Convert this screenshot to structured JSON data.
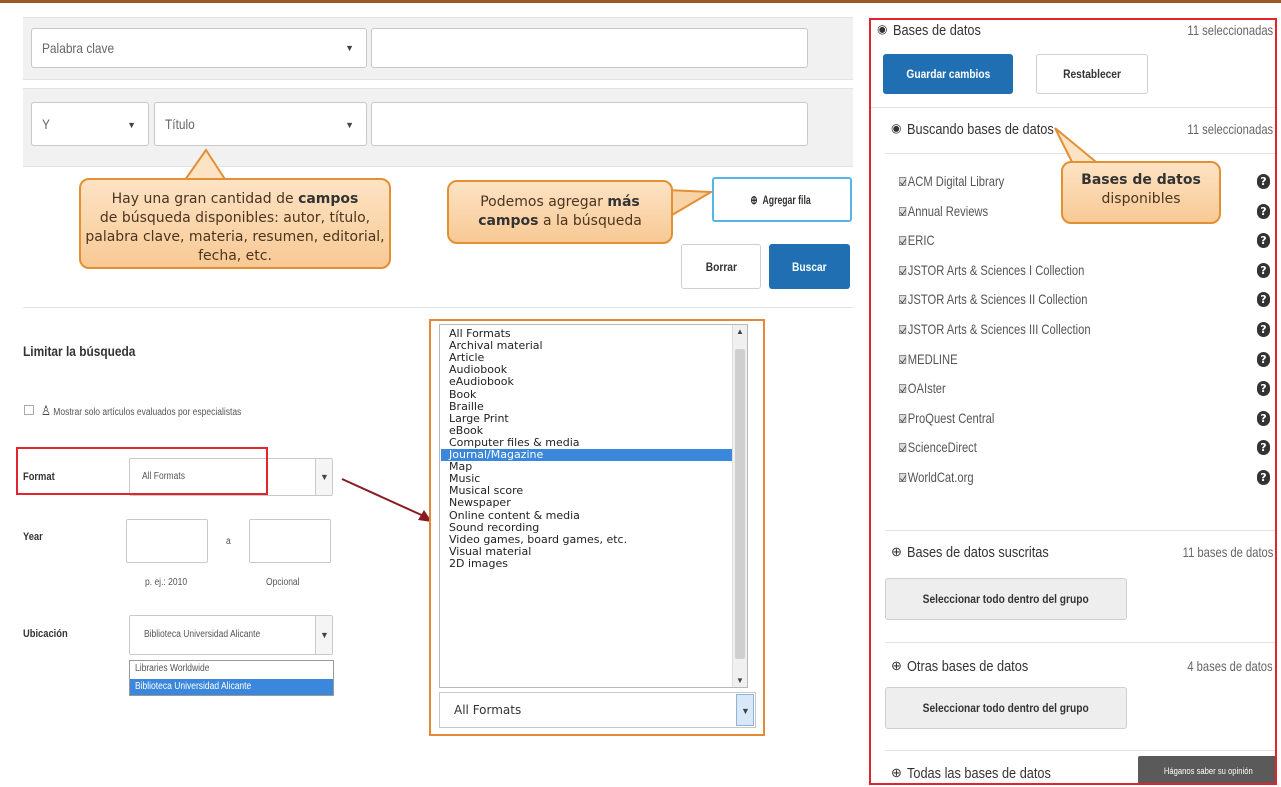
{
  "search": {
    "row1": {
      "field": "Palabra clave",
      "value": ""
    },
    "row2": {
      "operator": "Y",
      "field": "Título",
      "value": ""
    },
    "add_row_label": "Agregar fila",
    "clear_label": "Borrar",
    "search_label": "Buscar"
  },
  "callouts": {
    "fields_pre": "Hay una gran cantidad de ",
    "fields_bold": "campos",
    "fields_post": "de búsqueda disponibles: autor, título, palabra clave, materia, resumen, editorial, fecha, etc.",
    "add_pre": "Podemos agregar ",
    "add_bold1": "más",
    "add_bold2": "campos",
    "add_post": " a  la búsqueda",
    "db_bold": "Bases de datos",
    "db_post": "disponibles"
  },
  "limits": {
    "title": "Limitar la búsqueda",
    "peer_review": "Mostrar solo artículos evaluados por especialistas",
    "format_label": "Format",
    "format_value": "All Formats",
    "year_label": "Year",
    "year_from_placeholder": "p. ej.: 2010",
    "year_sep": "a",
    "year_to_placeholder": "Opcional",
    "location_label": "Ubicación",
    "location_value": "Biblioteca Universidad Alicante",
    "location_options": [
      "Libraries Worldwide",
      "Biblioteca Universidad Alicante"
    ]
  },
  "format_list": {
    "options": [
      "All Formats",
      "Archival material",
      "Article",
      "Audiobook",
      "eAudiobook",
      "Book",
      "Braille",
      "Large Print",
      "eBook",
      "Computer files & media",
      "Journal/Magazine",
      "Map",
      "Music",
      "Musical score",
      "Newspaper",
      "Online content & media",
      "Sound recording",
      "Video games, board games, etc.",
      "Visual material",
      "2D images"
    ],
    "selected": "Journal/Magazine",
    "current_value": "All Formats"
  },
  "databases": {
    "header_title": "Bases de datos",
    "header_count": "11 seleccionadas",
    "save_label": "Guardar cambios",
    "reset_label": "Restablecer",
    "searching_title": "Buscando bases de datos",
    "searching_count": "11 seleccionadas",
    "items": [
      "ACM Digital Library",
      "Annual Reviews",
      "ERIC",
      "JSTOR Arts & Sciences I Collection",
      "JSTOR Arts & Sciences II Collection",
      "JSTOR Arts & Sciences III Collection",
      "MEDLINE",
      "OAIster",
      "ProQuest Central",
      "ScienceDirect",
      "WorldCat.org"
    ],
    "help_glyph": "?",
    "subscribed_title": "Bases de datos suscritas",
    "subscribed_count": "11 bases de datos",
    "select_all_label": "Seleccionar todo dentro del grupo",
    "other_title": "Otras bases de datos",
    "other_count": "4 bases de datos",
    "all_title": "Todas las bases de datos",
    "feedback_label": "Háganos saber su opinión"
  },
  "colors": {
    "accent_blue": "#1f6fb2",
    "highlight_red": "#e0262c",
    "callout_orange": "#e38f33"
  }
}
